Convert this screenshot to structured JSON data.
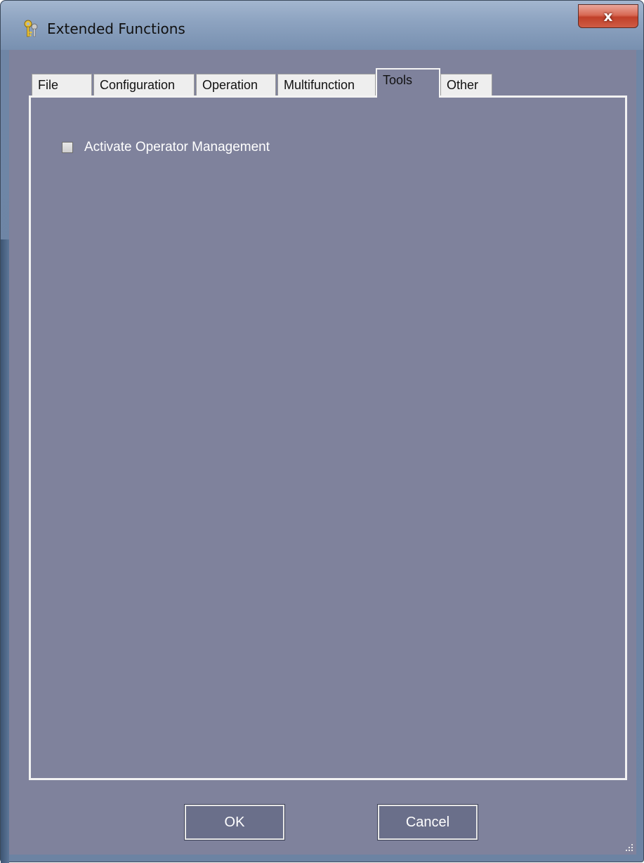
{
  "window": {
    "title": "Extended Functions",
    "close_label": "x"
  },
  "tabs": [
    {
      "label": "File",
      "active": false
    },
    {
      "label": "Configuration",
      "active": false
    },
    {
      "label": "Operation",
      "active": false
    },
    {
      "label": "Multifunction",
      "active": false
    },
    {
      "label": "Tools",
      "active": true
    },
    {
      "label": "Other",
      "active": false
    }
  ],
  "tools_page": {
    "checkbox_label": "Activate Operator Management",
    "checked": false
  },
  "buttons": {
    "ok_label": "OK",
    "cancel_label": "Cancel"
  },
  "icons": {
    "title": "keys-icon",
    "close": "close-icon",
    "resize": "resize-grip-icon"
  },
  "colors": {
    "panel_background": "#7f829c",
    "close_button": "#c0402a"
  }
}
